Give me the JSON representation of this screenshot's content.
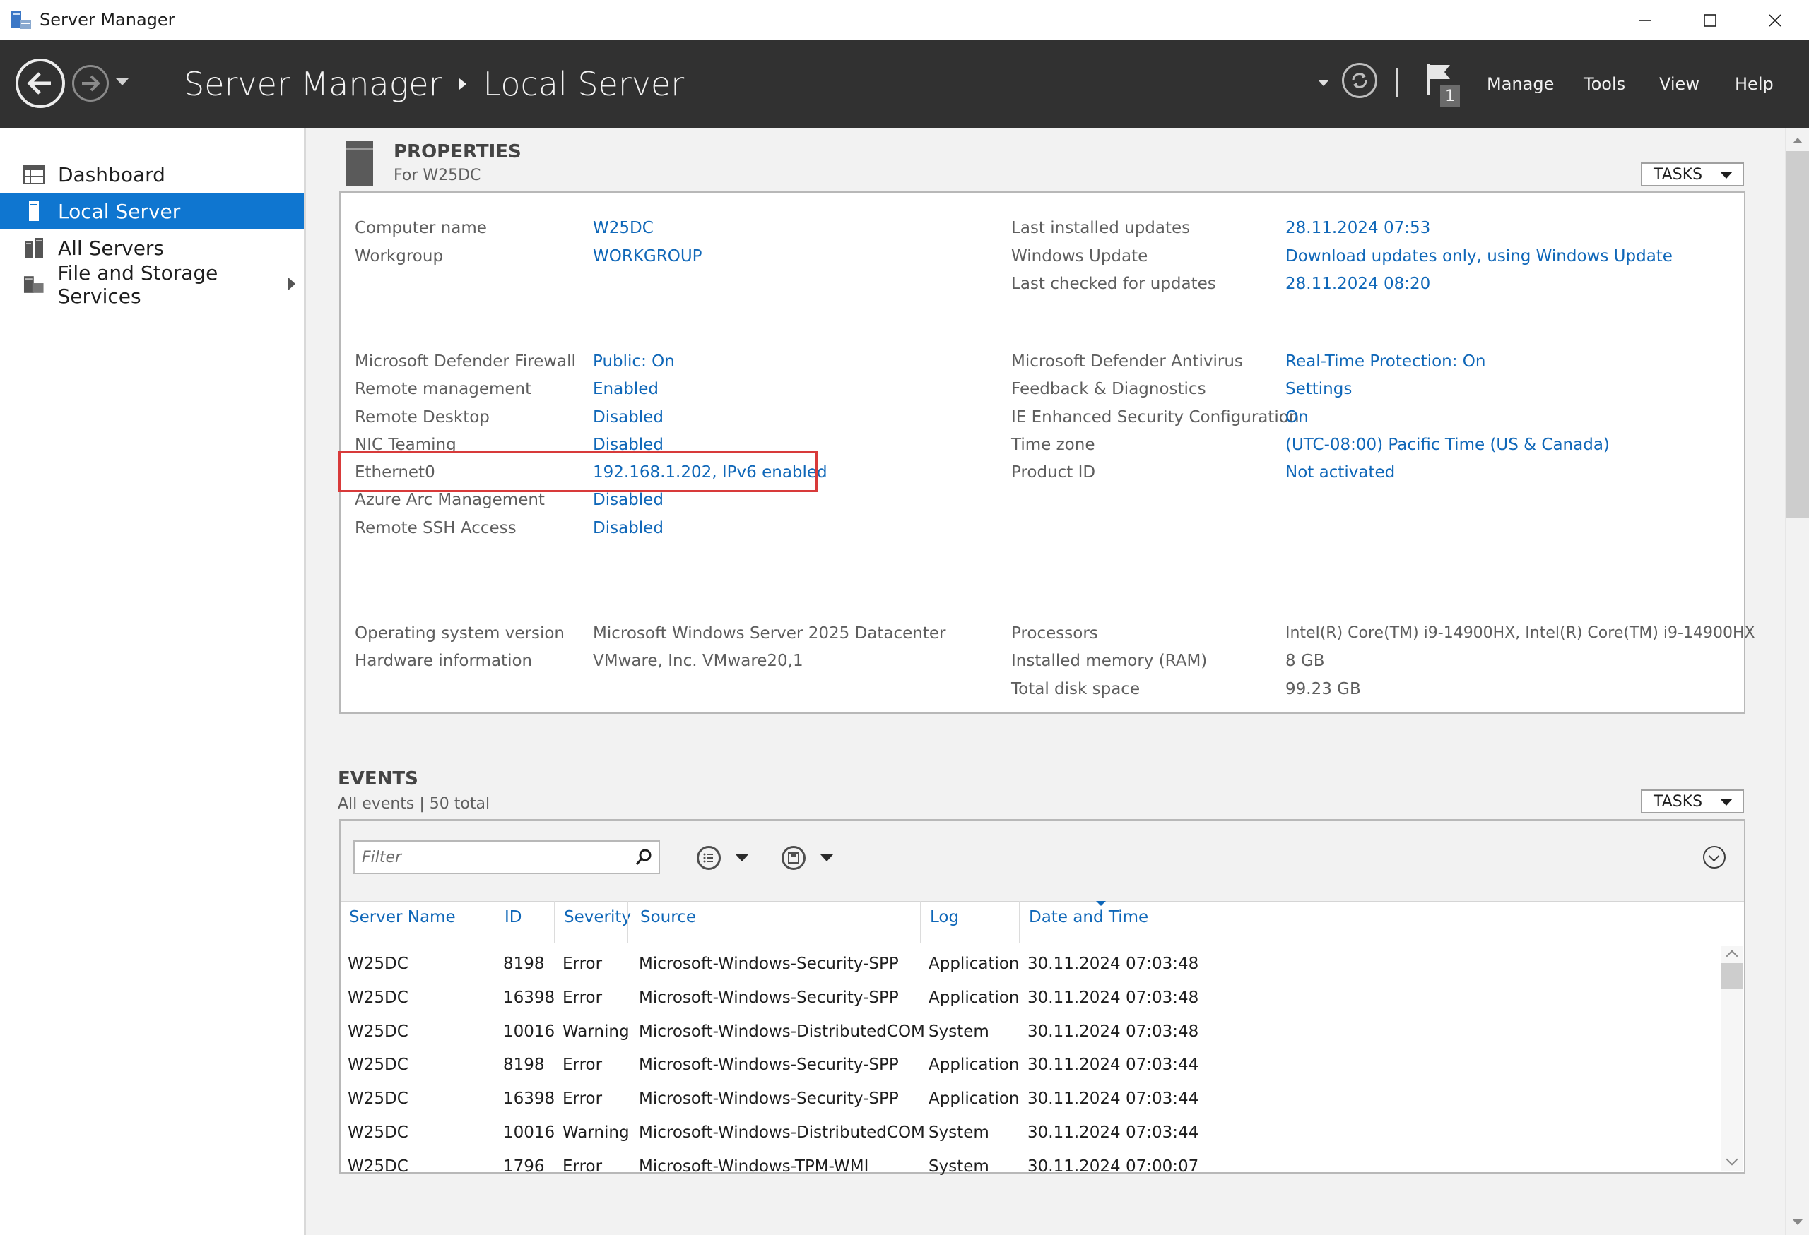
{
  "window": {
    "title": "Server Manager"
  },
  "header": {
    "breadcrumb_root": "Server Manager",
    "breadcrumb_current": "Local Server",
    "notification_count": "1",
    "menu": [
      "Manage",
      "Tools",
      "View",
      "Help"
    ]
  },
  "sidebar": {
    "items": [
      {
        "label": "Dashboard",
        "icon": "dashboard-icon"
      },
      {
        "label": "Local Server",
        "icon": "server-icon",
        "active": true
      },
      {
        "label": "All Servers",
        "icon": "servers-icon"
      },
      {
        "label": "File and Storage Services",
        "icon": "storage-icon"
      }
    ]
  },
  "properties": {
    "title": "PROPERTIES",
    "subtitle": "For W25DC",
    "tasks_label": "TASKS",
    "left": [
      {
        "label": "Computer name",
        "value": "W25DC"
      },
      {
        "label": "Workgroup",
        "value": "WORKGROUP"
      },
      {
        "label": "Microsoft Defender Firewall",
        "value": "Public: On"
      },
      {
        "label": "Remote management",
        "value": "Enabled"
      },
      {
        "label": "Remote Desktop",
        "value": "Disabled"
      },
      {
        "label": "NIC Teaming",
        "value": "Disabled"
      },
      {
        "label": "Ethernet0",
        "value": "192.168.1.202, IPv6 enabled"
      },
      {
        "label": "Azure Arc Management",
        "value": "Disabled"
      },
      {
        "label": "Remote SSH Access",
        "value": "Disabled"
      },
      {
        "label": "Operating system version",
        "value": "Microsoft Windows Server 2025 Datacenter"
      },
      {
        "label": "Hardware information",
        "value": "VMware, Inc. VMware20,1"
      }
    ],
    "right": [
      {
        "label": "Last installed updates",
        "value": "28.11.2024 07:53"
      },
      {
        "label": "Windows Update",
        "value": "Download updates only, using Windows Update"
      },
      {
        "label": "Last checked for updates",
        "value": "28.11.2024 08:20"
      },
      {
        "label": "Microsoft Defender Antivirus",
        "value": "Real-Time Protection: On"
      },
      {
        "label": "Feedback & Diagnostics",
        "value": "Settings"
      },
      {
        "label": "IE Enhanced Security Configuration",
        "value": "On"
      },
      {
        "label": "Time zone",
        "value": "(UTC-08:00) Pacific Time (US & Canada)"
      },
      {
        "label": "Product ID",
        "value": "Not activated"
      },
      {
        "label": "Processors",
        "value": "Intel(R) Core(TM) i9-14900HX, Intel(R) Core(TM) i9-14900HX"
      },
      {
        "label": "Installed memory (RAM)",
        "value": "8 GB"
      },
      {
        "label": "Total disk space",
        "value": "99.23 GB"
      }
    ]
  },
  "events": {
    "title": "EVENTS",
    "subtitle": "All events | 50 total",
    "tasks_label": "TASKS",
    "filter_placeholder": "Filter",
    "columns": [
      "Server Name",
      "ID",
      "Severity",
      "Source",
      "Log",
      "Date and Time"
    ],
    "rows": [
      [
        "W25DC",
        "8198",
        "Error",
        "Microsoft-Windows-Security-SPP",
        "Application",
        "30.11.2024 07:03:48"
      ],
      [
        "W25DC",
        "16398",
        "Error",
        "Microsoft-Windows-Security-SPP",
        "Application",
        "30.11.2024 07:03:48"
      ],
      [
        "W25DC",
        "10016",
        "Warning",
        "Microsoft-Windows-DistributedCOM",
        "System",
        "30.11.2024 07:03:48"
      ],
      [
        "W25DC",
        "8198",
        "Error",
        "Microsoft-Windows-Security-SPP",
        "Application",
        "30.11.2024 07:03:44"
      ],
      [
        "W25DC",
        "16398",
        "Error",
        "Microsoft-Windows-Security-SPP",
        "Application",
        "30.11.2024 07:03:44"
      ],
      [
        "W25DC",
        "10016",
        "Warning",
        "Microsoft-Windows-DistributedCOM",
        "System",
        "30.11.2024 07:03:44"
      ],
      [
        "W25DC",
        "1796",
        "Error",
        "Microsoft-Windows-TPM-WMI",
        "System",
        "30.11.2024 07:00:07"
      ]
    ]
  },
  "colors": {
    "accent": "#0f76d0",
    "link": "#0f67b8",
    "header_bg": "#313131",
    "highlight": "#d83a3a"
  }
}
